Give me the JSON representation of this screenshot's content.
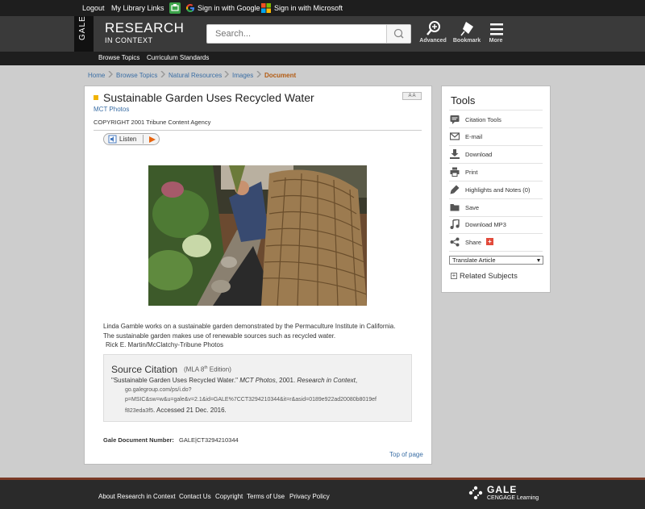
{
  "topbar": {
    "logout": "Logout",
    "library_links": "My Library Links",
    "google": "Sign in with Google",
    "microsoft": "Sign in with Microsoft"
  },
  "header": {
    "tab": "GALE",
    "logo_main": "RESEARCH",
    "logo_sub": "IN CONTEXT",
    "search_placeholder": "Search...",
    "advanced": "Advanced",
    "bookmark": "Bookmark",
    "more": "More"
  },
  "nav": {
    "browse_topics": "Browse Topics",
    "curriculum": "Curriculum Standards"
  },
  "breadcrumb": [
    "Home",
    "Browse Topics",
    "Natural Resources",
    "Images",
    "Document"
  ],
  "document": {
    "title": "Sustainable Garden Uses Recycled Water",
    "source": "MCT Photos",
    "copyright": "COPYRIGHT 2001 Tribune Content Agency",
    "font_buttons": "A A",
    "listen": "Listen",
    "caption": "Linda Gamble works on a sustainable garden demonstrated by the Permaculture Institute in California. The sustainable garden makes use of renewable sources such as recycled water.",
    "credit": "Rick E. Martin/McClatchy-Tribune Photos",
    "citation": {
      "heading": "Source Citation",
      "edition_a": "(MLA 8",
      "edition_sup": "th",
      "edition_b": " Edition)",
      "line1_a": "\"Sustainable Garden Uses Recycled Water.\" ",
      "line1_b": "MCT Photos",
      "line1_c": ", 2001. ",
      "line1_d": "Research in Context",
      "line1_e": ",",
      "url1": "go.galegroup.com/ps/i.do?",
      "url2": "p=MSIC&sw=w&u=gale&v=2.1&id=GALE%7CCT3294210344&it=r&asid=0189e922ad20080b8019ef",
      "url3a": "f823eda3f5",
      "url3b": ". Accessed 21 Dec. 2016."
    },
    "docnum_label": "Gale Document Number:",
    "docnum_value": "GALE|CT3294210344",
    "top_link": "Top of page"
  },
  "tools": {
    "heading": "Tools",
    "items": [
      {
        "label": "Citation Tools",
        "icon": "citation-icon"
      },
      {
        "label": "E-mail",
        "icon": "email-icon"
      },
      {
        "label": "Download",
        "icon": "download-icon"
      },
      {
        "label": "Print",
        "icon": "print-icon"
      },
      {
        "label": "Highlights and Notes (0)",
        "icon": "highlight-icon"
      },
      {
        "label": "Save",
        "icon": "folder-icon"
      },
      {
        "label": "Download MP3",
        "icon": "music-icon"
      },
      {
        "label": "Share",
        "icon": "share-icon"
      }
    ],
    "share_plus": "+",
    "translate": "Translate Article",
    "related_toggle": "+",
    "related": "Related Subjects"
  },
  "footer": {
    "about": "About Research in Context",
    "contact": "Contact Us",
    "copyright": "Copyright",
    "terms": "Terms of Use",
    "privacy": "Privacy Policy",
    "brand": "GALE",
    "brand_sub": "CENGAGE Learning"
  },
  "colors": {
    "link": "#3a6ea5",
    "current_crumb": "#b35b12",
    "title_marker": "#f1b300",
    "share_plus": "#e24a3b"
  }
}
